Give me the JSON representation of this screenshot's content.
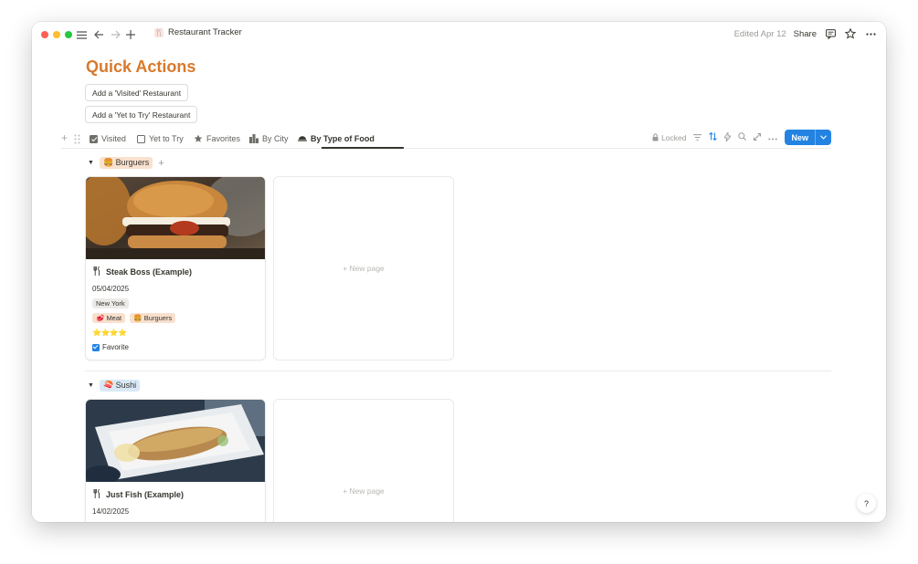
{
  "window": {
    "breadcrumb": "Restaurant Tracker",
    "edited": "Edited Apr 12",
    "share": "Share"
  },
  "page": {
    "title": "Quick Actions",
    "buttons": [
      "Add a 'Visited' Restaurant",
      "Add a 'Yet to Try' Restaurant"
    ]
  },
  "views": {
    "tabs": [
      {
        "label": "Visited",
        "icon": "checkbox-checked-icon"
      },
      {
        "label": "Yet to Try",
        "icon": "checkbox-empty-icon"
      },
      {
        "label": "Favorites",
        "icon": "star-icon"
      },
      {
        "label": "By City",
        "icon": "city-icon"
      },
      {
        "label": "By Type of Food",
        "icon": "food-icon",
        "active": true
      }
    ],
    "locked": "Locked",
    "new_label": "New"
  },
  "groups": [
    {
      "emoji": "🍔",
      "name": "Burguers",
      "color": "#fae1cf",
      "card": {
        "title": "Steak Boss (Example)",
        "date": "05/04/2025",
        "city": "New York",
        "tags": [
          {
            "emoji": "🥩",
            "label": "Meat"
          },
          {
            "emoji": "🍔",
            "label": "Burguers"
          }
        ],
        "rating": "⭐⭐⭐⭐",
        "favorite_label": "Favorite"
      },
      "new_page": "+ New page"
    },
    {
      "emoji": "🍣",
      "name": "Sushi",
      "color": "#d8e8f6",
      "card": {
        "title": "Just Fish (Example)",
        "date": "14/02/2025"
      },
      "new_page": "+ New page"
    }
  ],
  "help": "?"
}
